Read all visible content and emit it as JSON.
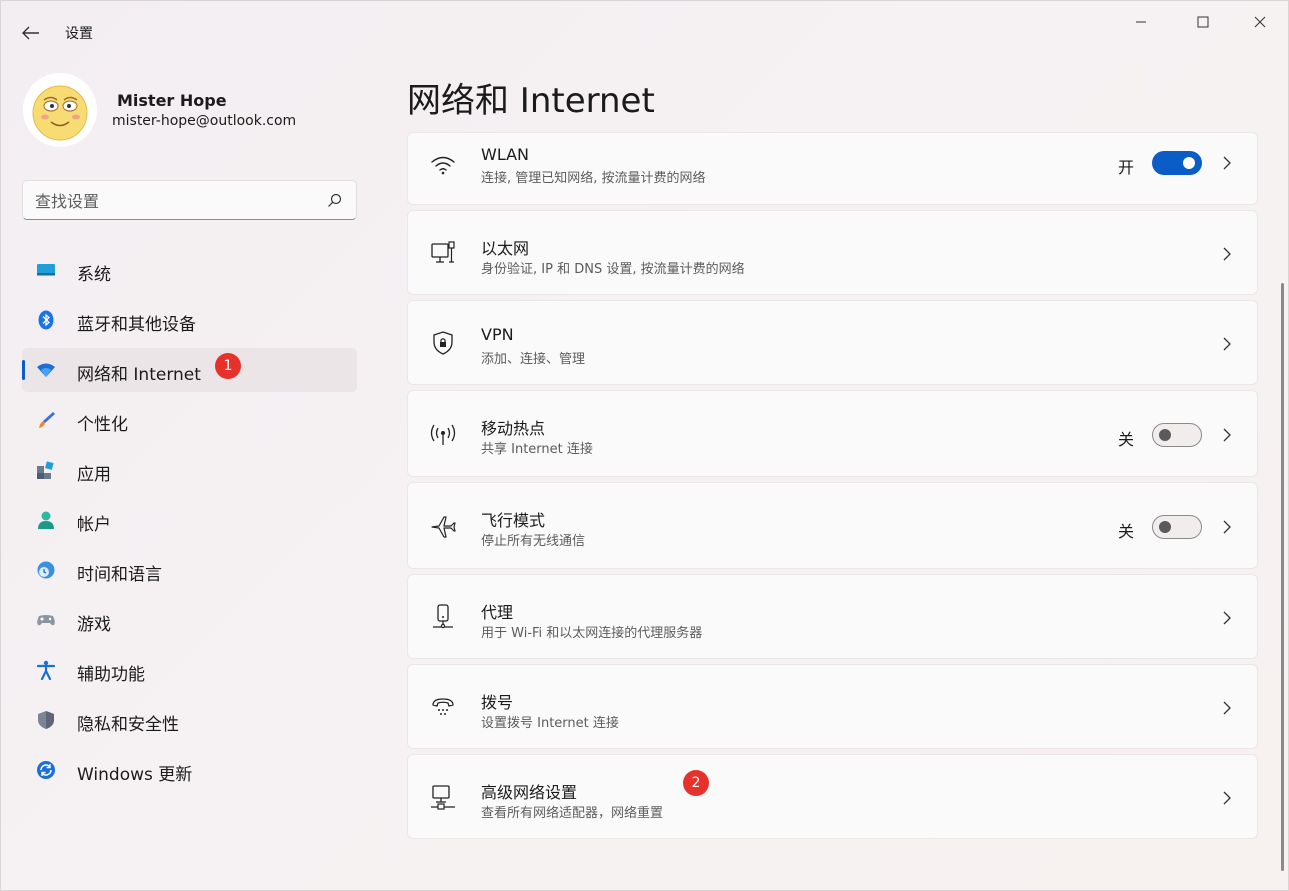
{
  "app": {
    "title": "设置"
  },
  "profile": {
    "name": "Mister Hope",
    "email": "mister-hope@outlook.com"
  },
  "search": {
    "placeholder": "查找设置"
  },
  "sidebar": {
    "items": [
      {
        "label": "系统",
        "icon": "system-icon"
      },
      {
        "label": "蓝牙和其他设备",
        "icon": "bluetooth-icon"
      },
      {
        "label": "网络和 Internet",
        "icon": "wifi-icon",
        "active": true,
        "badge": "1"
      },
      {
        "label": "个性化",
        "icon": "brush-icon"
      },
      {
        "label": "应用",
        "icon": "apps-icon"
      },
      {
        "label": "帐户",
        "icon": "account-icon"
      },
      {
        "label": "时间和语言",
        "icon": "time-language-icon"
      },
      {
        "label": "游戏",
        "icon": "gamepad-icon"
      },
      {
        "label": "辅助功能",
        "icon": "accessibility-icon"
      },
      {
        "label": "隐私和安全性",
        "icon": "shield-icon"
      },
      {
        "label": "Windows 更新",
        "icon": "update-icon"
      }
    ]
  },
  "main": {
    "title": "网络和 Internet",
    "cards": [
      {
        "title": "WLAN",
        "subtitle": "连接, 管理已知网络, 按流量计费的网络",
        "toggle_label": "开",
        "toggle_on": true
      },
      {
        "title": "以太网",
        "subtitle": "身份验证, IP 和 DNS 设置, 按流量计费的网络"
      },
      {
        "title": "VPN",
        "subtitle": "添加、连接、管理"
      },
      {
        "title": "移动热点",
        "subtitle": "共享 Internet 连接",
        "toggle_label": "关",
        "toggle_on": false
      },
      {
        "title": "飞行模式",
        "subtitle": "停止所有无线通信",
        "toggle_label": "关",
        "toggle_on": false
      },
      {
        "title": "代理",
        "subtitle": "用于 Wi-Fi 和以太网连接的代理服务器"
      },
      {
        "title": "拨号",
        "subtitle": "设置拨号 Internet 连接"
      },
      {
        "title": "高级网络设置",
        "subtitle": "查看所有网络适配器，网络重置",
        "badge": "2"
      }
    ]
  },
  "colors": {
    "accent": "#0a5cc7",
    "badge": "#e8312b"
  }
}
